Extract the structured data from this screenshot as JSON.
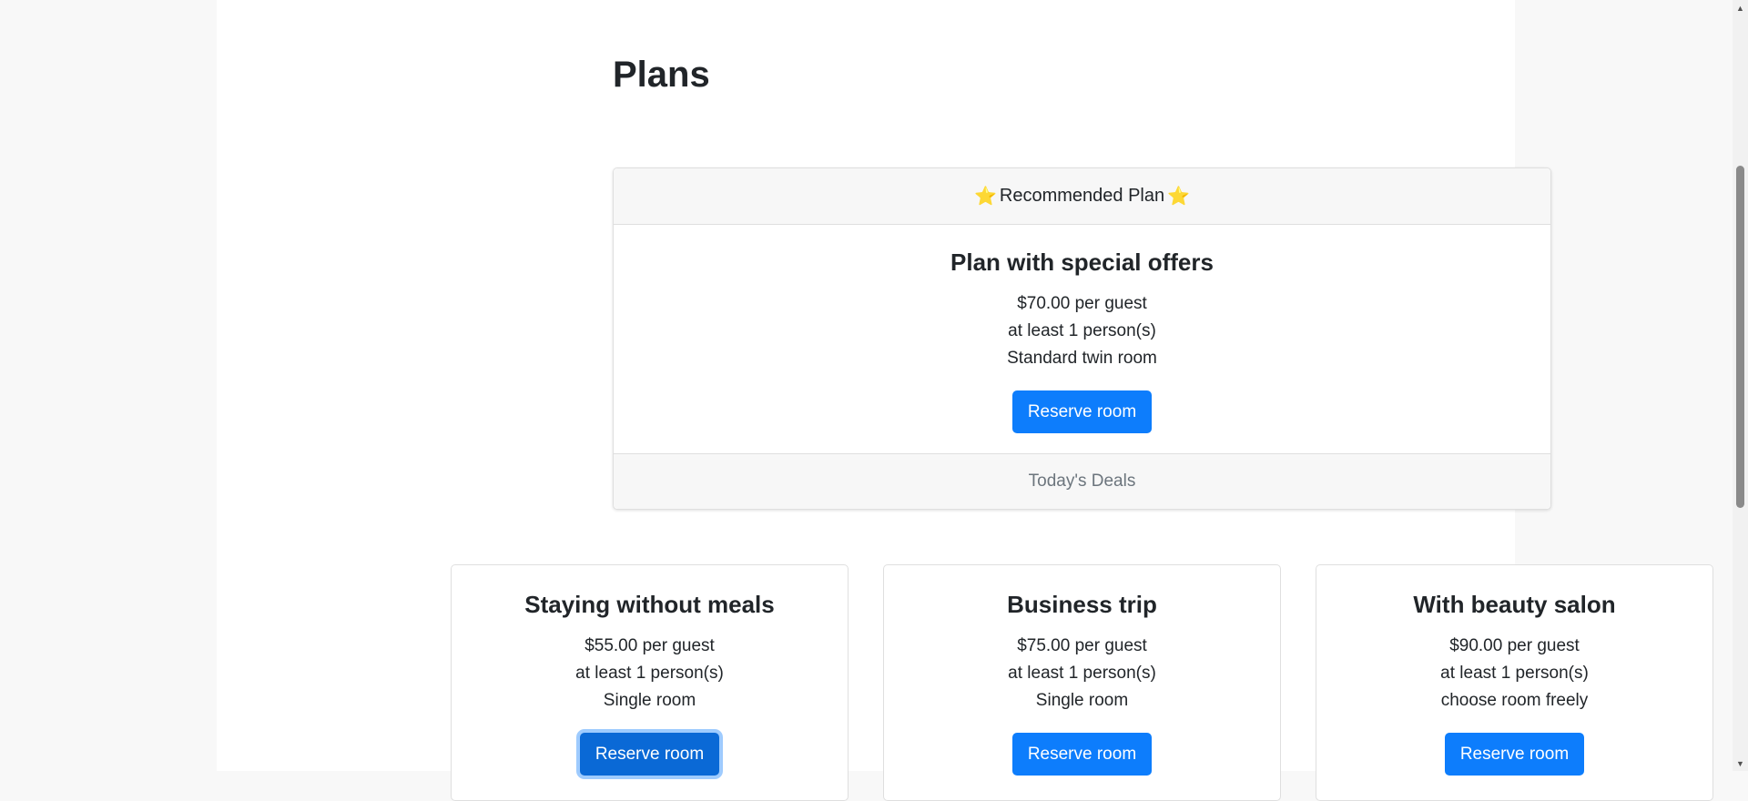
{
  "page": {
    "title": "Plans"
  },
  "recommended": {
    "header_label": "Recommended Plan",
    "star_left": "⭐",
    "star_right": "⭐",
    "name": "Plan with special offers",
    "price": "$70.00 per guest",
    "min_guests": "at least 1 person(s)",
    "room": "Standard twin room",
    "button_label": "Reserve room",
    "footer": "Today's Deals"
  },
  "plans": [
    {
      "name": "Staying without meals",
      "price": "$55.00 per guest",
      "min_guests": "at least 1 person(s)",
      "room": "Single room",
      "button_label": "Reserve room"
    },
    {
      "name": "Business trip",
      "price": "$75.00 per guest",
      "min_guests": "at least 1 person(s)",
      "room": "Single room",
      "button_label": "Reserve room"
    },
    {
      "name": "With beauty salon",
      "price": "$90.00 per guest",
      "min_guests": "at least 1 person(s)",
      "room": "choose room freely",
      "button_label": "Reserve room"
    }
  ],
  "scrollbar": {
    "up_arrow": "▲",
    "down_arrow": "▼"
  },
  "colors": {
    "primary_button": "#0d7dfc",
    "card_header_bg": "#f7f7f7",
    "muted_text": "#6c757d"
  }
}
